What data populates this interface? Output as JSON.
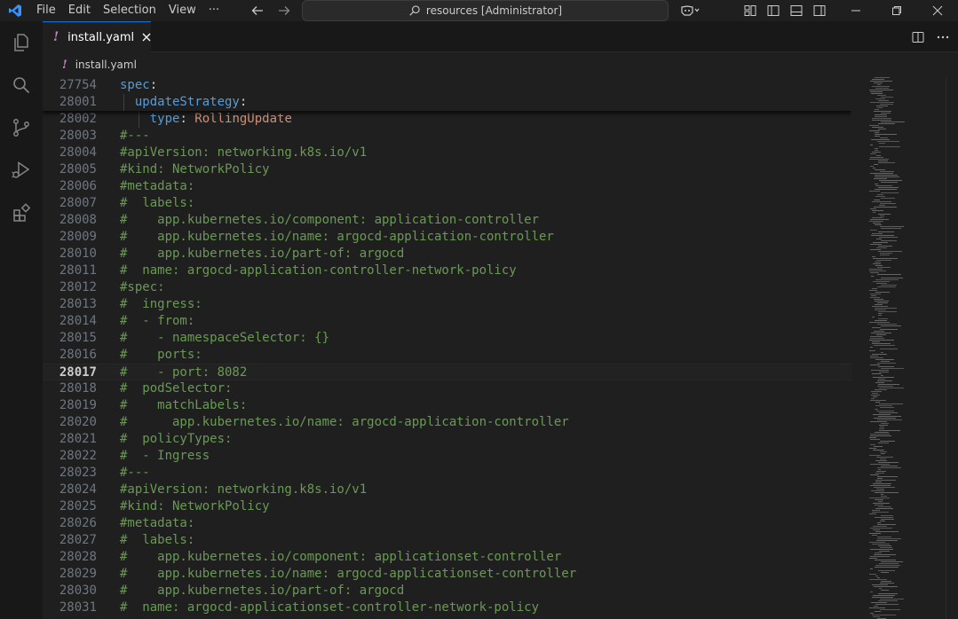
{
  "titlebar": {
    "menu": [
      "File",
      "Edit",
      "Selection",
      "View",
      "···"
    ],
    "search_text": "resources [Administrator]"
  },
  "tabs": [
    {
      "label": "install.yaml",
      "icon": "yaml-exclamation-icon",
      "active": true
    }
  ],
  "breadcrumb": {
    "label": "install.yaml",
    "icon": "yaml-exclamation-icon"
  },
  "editor": {
    "sticky_lines": [
      {
        "number": "27754",
        "tokens": [
          [
            "k",
            "spec"
          ],
          [
            "p",
            ":"
          ]
        ]
      },
      {
        "number": "28001",
        "tokens": [
          [
            "p",
            "  "
          ],
          [
            "k",
            "updateStrategy"
          ],
          [
            "p",
            ":"
          ]
        ]
      }
    ],
    "lines": [
      {
        "number": "28002",
        "tokens": [
          [
            "p",
            "    "
          ],
          [
            "k",
            "type"
          ],
          [
            "p",
            ": "
          ],
          [
            "s",
            "RollingUpdate"
          ]
        ]
      },
      {
        "number": "28003",
        "tokens": [
          [
            "c",
            "#---"
          ]
        ]
      },
      {
        "number": "28004",
        "tokens": [
          [
            "c",
            "#apiVersion: networking.k8s.io/v1"
          ]
        ]
      },
      {
        "number": "28005",
        "tokens": [
          [
            "c",
            "#kind: NetworkPolicy"
          ]
        ]
      },
      {
        "number": "28006",
        "tokens": [
          [
            "c",
            "#metadata:"
          ]
        ]
      },
      {
        "number": "28007",
        "tokens": [
          [
            "c",
            "#  labels:"
          ]
        ]
      },
      {
        "number": "28008",
        "tokens": [
          [
            "c",
            "#    app.kubernetes.io/component: application-controller"
          ]
        ]
      },
      {
        "number": "28009",
        "tokens": [
          [
            "c",
            "#    app.kubernetes.io/name: argocd-application-controller"
          ]
        ]
      },
      {
        "number": "28010",
        "tokens": [
          [
            "c",
            "#    app.kubernetes.io/part-of: argocd"
          ]
        ]
      },
      {
        "number": "28011",
        "tokens": [
          [
            "c",
            "#  name: argocd-application-controller-network-policy"
          ]
        ]
      },
      {
        "number": "28012",
        "tokens": [
          [
            "c",
            "#spec:"
          ]
        ]
      },
      {
        "number": "28013",
        "tokens": [
          [
            "c",
            "#  ingress:"
          ]
        ]
      },
      {
        "number": "28014",
        "tokens": [
          [
            "c",
            "#  - from:"
          ]
        ]
      },
      {
        "number": "28015",
        "tokens": [
          [
            "c",
            "#    - namespaceSelector: {}"
          ]
        ]
      },
      {
        "number": "28016",
        "tokens": [
          [
            "c",
            "#    ports:"
          ]
        ]
      },
      {
        "number": "28017",
        "tokens": [
          [
            "c",
            "#    - port: 8082"
          ]
        ],
        "current": true
      },
      {
        "number": "28018",
        "tokens": [
          [
            "c",
            "#  podSelector:"
          ]
        ]
      },
      {
        "number": "28019",
        "tokens": [
          [
            "c",
            "#    matchLabels:"
          ]
        ]
      },
      {
        "number": "28020",
        "tokens": [
          [
            "c",
            "#      app.kubernetes.io/name: argocd-application-controller"
          ]
        ]
      },
      {
        "number": "28021",
        "tokens": [
          [
            "c",
            "#  policyTypes:"
          ]
        ]
      },
      {
        "number": "28022",
        "tokens": [
          [
            "c",
            "#  - Ingress"
          ]
        ]
      },
      {
        "number": "28023",
        "tokens": [
          [
            "c",
            "#---"
          ]
        ]
      },
      {
        "number": "28024",
        "tokens": [
          [
            "c",
            "#apiVersion: networking.k8s.io/v1"
          ]
        ]
      },
      {
        "number": "28025",
        "tokens": [
          [
            "c",
            "#kind: NetworkPolicy"
          ]
        ]
      },
      {
        "number": "28026",
        "tokens": [
          [
            "c",
            "#metadata:"
          ]
        ]
      },
      {
        "number": "28027",
        "tokens": [
          [
            "c",
            "#  labels:"
          ]
        ]
      },
      {
        "number": "28028",
        "tokens": [
          [
            "c",
            "#    app.kubernetes.io/component: applicationset-controller"
          ]
        ]
      },
      {
        "number": "28029",
        "tokens": [
          [
            "c",
            "#    app.kubernetes.io/name: argocd-applicationset-controller"
          ]
        ]
      },
      {
        "number": "28030",
        "tokens": [
          [
            "c",
            "#    app.kubernetes.io/part-of: argocd"
          ]
        ]
      },
      {
        "number": "28031",
        "tokens": [
          [
            "c",
            "#  name: argocd-applicationset-controller-network-policy"
          ]
        ]
      }
    ]
  },
  "colors": {
    "keyword": "#569cd6",
    "comment": "#6a9955",
    "string": "#ce9178",
    "accent": "#0078d4",
    "yaml_icon": "#c586c0"
  },
  "activity_icons": [
    "explorer-icon",
    "search-icon",
    "source-control-icon",
    "run-debug-icon",
    "extensions-icon"
  ]
}
